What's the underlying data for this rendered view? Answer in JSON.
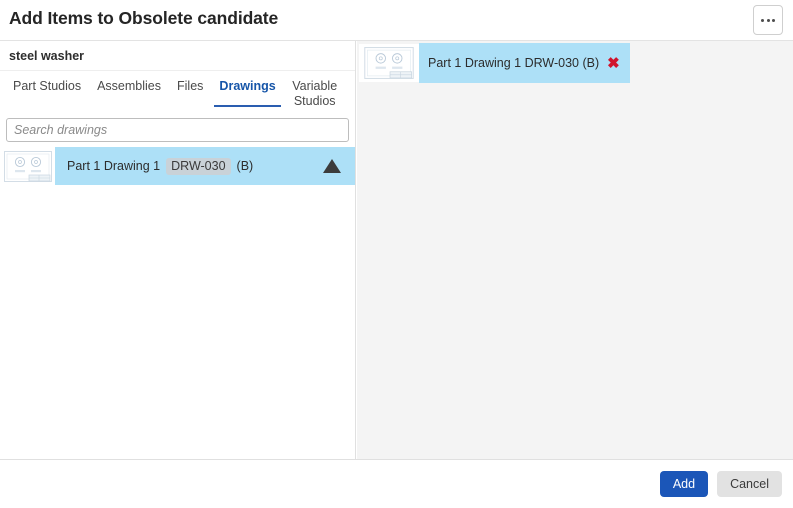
{
  "header": {
    "title": "Add Items to Obsolete candidate",
    "more_icon": "ellipsis-icon"
  },
  "left_pane": {
    "document_name": "steel washer",
    "tabs": [
      {
        "label": "Part Studios",
        "active": false
      },
      {
        "label": "Assemblies",
        "active": false
      },
      {
        "label": "Files",
        "active": false
      },
      {
        "label": "Drawings",
        "active": true
      },
      {
        "label": "Variable Studios",
        "active": false
      }
    ],
    "search": {
      "value": "",
      "placeholder": "Search drawings",
      "icon": "search-icon"
    },
    "results": [
      {
        "thumbnail": "drawing-sheet-thumbnail",
        "title": "Part 1 Drawing 1",
        "badge": "DRW-030",
        "revision": "(B)",
        "selected": true,
        "trailing_icon": "triangle-up-icon"
      }
    ]
  },
  "right_pane": {
    "selected_items": [
      {
        "thumbnail": "drawing-sheet-thumbnail",
        "label": "Part 1 Drawing 1 DRW-030 (B)",
        "remove_icon": "red-x-icon",
        "remove_glyph": "✖"
      }
    ]
  },
  "footer": {
    "add_label": "Add",
    "cancel_label": "Cancel"
  },
  "colors": {
    "accent_blue": "#1b56b8",
    "tab_active_blue": "#1655a8",
    "selection_blue": "#ade0f7",
    "badge_gray": "#c9d2d8",
    "remove_red": "#d0142c",
    "right_pane_bg": "#f4f4f4"
  }
}
